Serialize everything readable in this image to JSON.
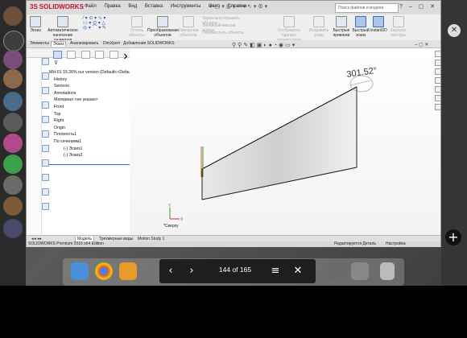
{
  "app": {
    "logo_text": "SOLIDWORKS",
    "menu": [
      "Файл",
      "Правка",
      "Вид",
      "Вставка",
      "Инструменты",
      "Окно",
      "Справка"
    ],
    "search_placeholder": "Поиск файлов и модели"
  },
  "ribbon": {
    "buttons": [
      {
        "label": "Эскиз",
        "state": "normal"
      },
      {
        "label": "Автоматическое нанесение размеров",
        "state": "normal"
      },
      {
        "label": "Отсечь объекты",
        "state": "disabled"
      },
      {
        "label": "Преобразование объектов",
        "state": "normal"
      },
      {
        "label": "Смещение объектов",
        "state": "disabled"
      },
      {
        "label": "Зеркально отразить объекты",
        "state": "disabled"
      },
      {
        "label": "Линейный массив эскиза",
        "state": "disabled"
      },
      {
        "label": "Переместить объекты",
        "state": "disabled"
      },
      {
        "label": "Отобразить/Удалить взаимосвязи",
        "state": "disabled"
      },
      {
        "label": "Исправить эскиз",
        "state": "disabled"
      },
      {
        "label": "Быстрые привязки",
        "state": "normal"
      },
      {
        "label": "Быстрый эскиз",
        "state": "active"
      },
      {
        "label": "Instant2D",
        "state": "active"
      },
      {
        "label": "Заштрих. контуры",
        "state": "disabled"
      }
    ]
  },
  "command_tabs": [
    "Элементы",
    "Эскиз",
    "Анализировать",
    "DimXpert",
    "Добавления SOLIDWORKS"
  ],
  "feature_tree": {
    "root": "МН-01 15.26% our version  (Default<<Default>",
    "items": [
      "History",
      "Sensors",
      "Annotations",
      "Материал <не указан>",
      "Front",
      "Top",
      "Right",
      "Origin",
      "Плоскость1",
      "По сечениям1",
      "(-) Эскиз1",
      "(-) Эскиз2"
    ]
  },
  "graphics": {
    "dimension_value": "301.52°",
    "triad_x": "X",
    "triad_y": "Y",
    "view_label": "*Сверху"
  },
  "bottom_tabs": [
    "Модель",
    "Трехмерные виды",
    "Motion Study 1"
  ],
  "status": {
    "left": "SOLIDWORKS Premium 2016 x64 Edition",
    "middle": "Редактируется Деталь",
    "right": "Настройка"
  },
  "pager": {
    "text": "144 of 165"
  }
}
